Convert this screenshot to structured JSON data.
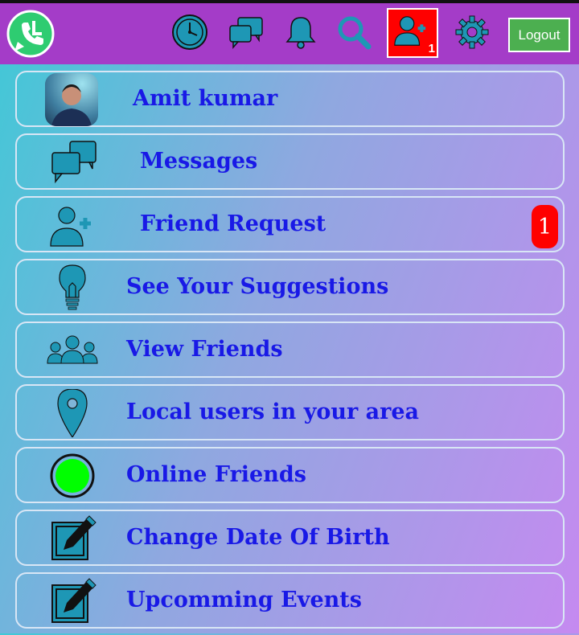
{
  "header": {
    "logout_label": "Logout",
    "friend_request_count": "1",
    "icons": [
      "clock-icon",
      "chat-icon",
      "bell-icon",
      "search-icon",
      "add-friend-icon",
      "gear-icon"
    ]
  },
  "menu": {
    "items": [
      {
        "label": "Amit kumar",
        "icon": "avatar"
      },
      {
        "label": "Messages",
        "icon": "chat-icon"
      },
      {
        "label": "Friend Request",
        "icon": "add-friend-icon",
        "badge": "1"
      },
      {
        "label": "See Your Suggestions",
        "icon": "lightbulb-icon"
      },
      {
        "label": "View Friends",
        "icon": "group-icon"
      },
      {
        "label": "Local users in your area",
        "icon": "location-pin-icon"
      },
      {
        "label": "Online Friends",
        "icon": "online-dot-icon"
      },
      {
        "label": "Change Date Of Birth",
        "icon": "edit-icon"
      },
      {
        "label": "Upcomming Events",
        "icon": "edit-icon"
      }
    ]
  },
  "colors": {
    "topbar": "#a43cc8",
    "label": "#1919e6",
    "icon": "#1e97b5",
    "badge": "#ff0000",
    "logout": "#4caf50",
    "online": "#00ff00"
  }
}
